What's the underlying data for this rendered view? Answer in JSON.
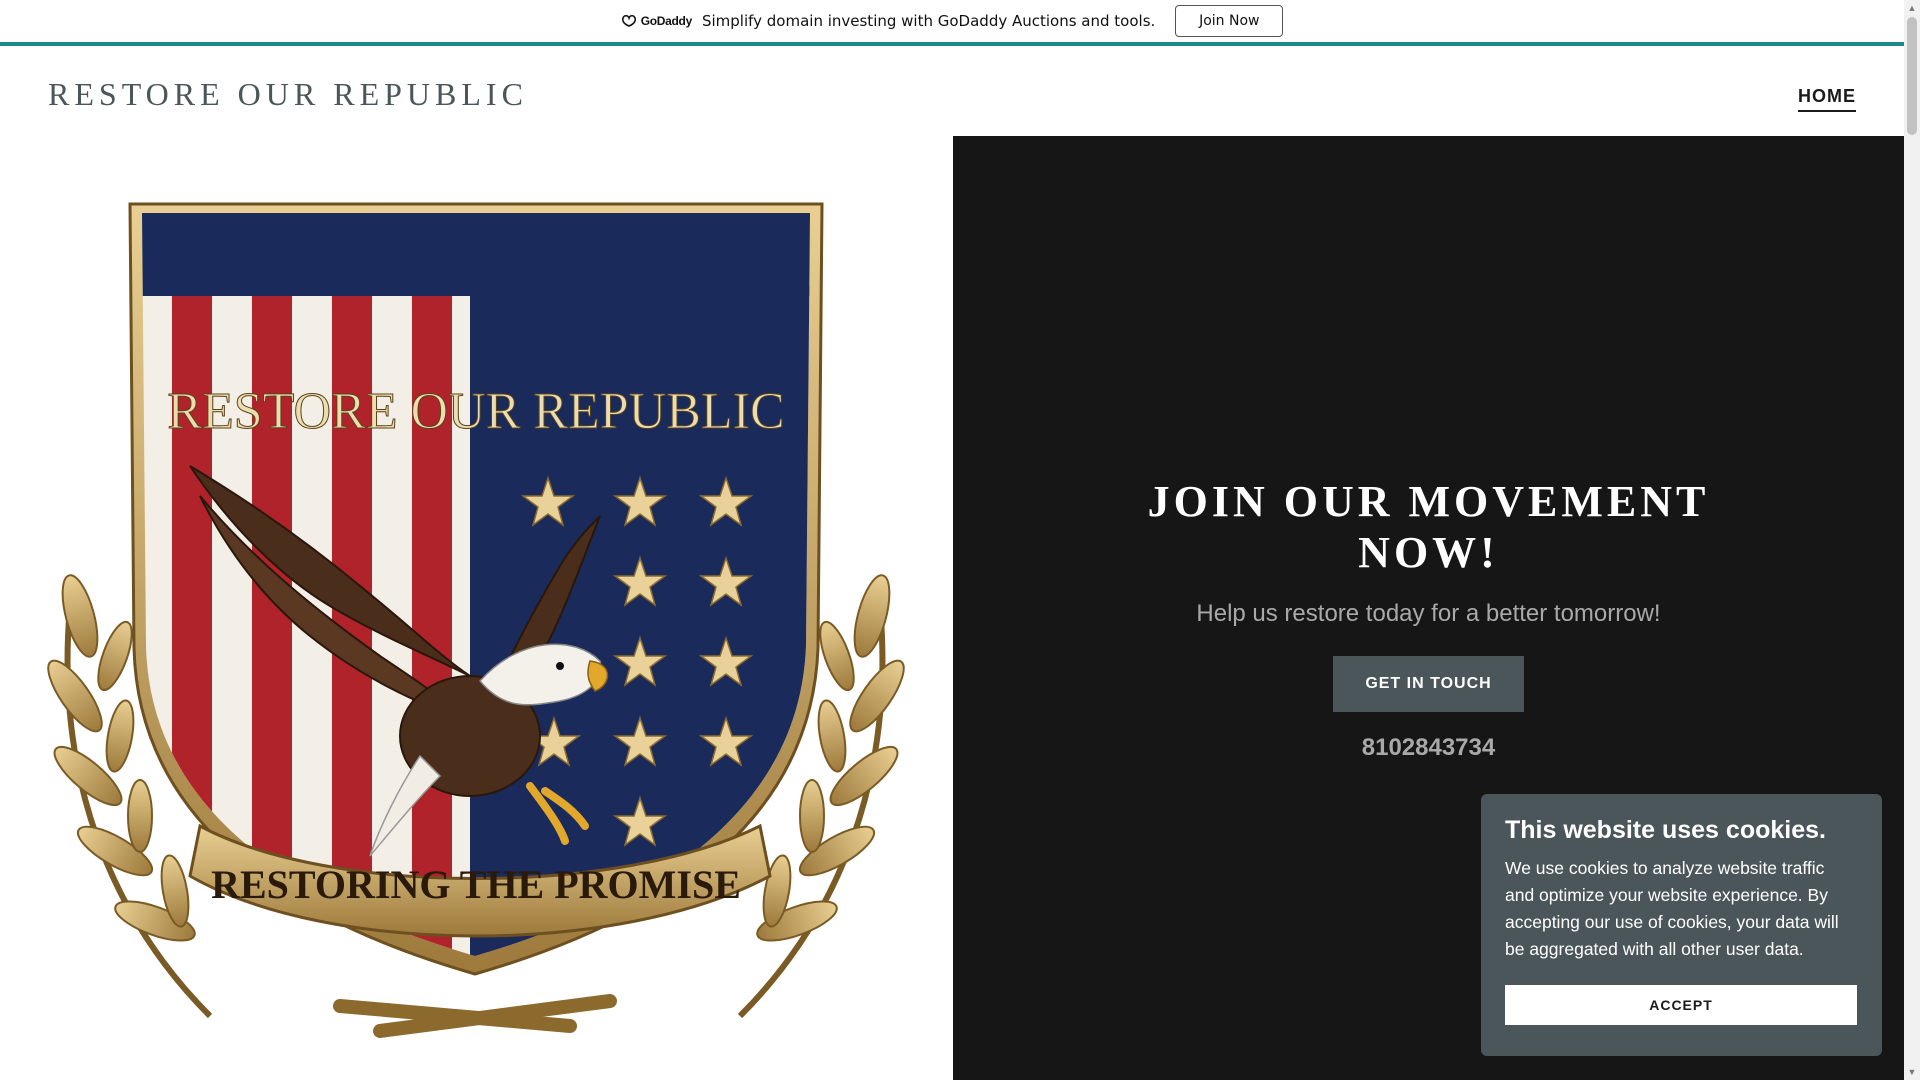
{
  "promo": {
    "brand": "GoDaddy",
    "text": "Simplify domain investing with GoDaddy Auctions and tools.",
    "button_label": "Join Now"
  },
  "header": {
    "site_title": "RESTORE OUR REPUBLIC",
    "nav_home": "HOME"
  },
  "emblem": {
    "top_text": "RESTORE OUR REPUBLIC",
    "banner_text": "RESTORING THE PROMISE"
  },
  "hero": {
    "title": "JOIN OUR MOVEMENT NOW!",
    "subtitle": "Help us restore today for a better tomorrow!",
    "cta_label": "GET IN TOUCH",
    "phone": "8102843734"
  },
  "cookie": {
    "title": "This website uses cookies.",
    "body": "We use cookies to analyze website traffic and optimize your website experience. By accepting our use of cookies, your data will be aggregated with all other user data.",
    "accept_label": "ACCEPT"
  },
  "scrollbar": {
    "up_glyph": "▲",
    "down_glyph": "▼"
  },
  "colors": {
    "accent": "#1c8a8c",
    "dark_panel": "#161616",
    "cta": "#4b565a",
    "navy": "#1a2a5a",
    "red": "#b0232a",
    "gold": "#c9a45a"
  }
}
